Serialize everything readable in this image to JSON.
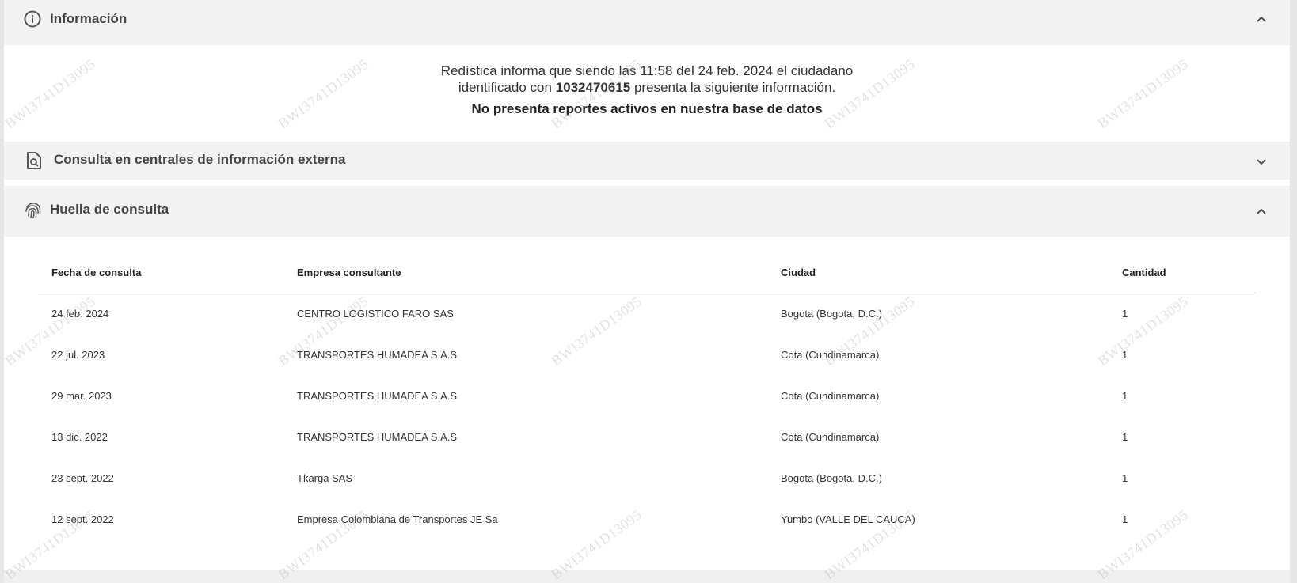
{
  "sections": {
    "informacion": {
      "title": "Información",
      "icon": "info-circle-icon",
      "expanded": true
    },
    "consulta_externa": {
      "title": "Consulta en centrales de información externa",
      "icon": "document-search-icon",
      "expanded": false
    },
    "huella": {
      "title": "Huella de consulta",
      "icon": "fingerprint-icon",
      "expanded": true
    }
  },
  "info": {
    "line1": "Redística informa que siendo las 11:58 del 24 feb. 2024 el ciudadano",
    "line2_prefix": "identificado con ",
    "id_number": "1032470615",
    "line2_suffix": " presenta la siguiente información.",
    "status": "No presenta reportes activos en nuestra base de datos"
  },
  "table": {
    "headers": [
      "Fecha de consulta",
      "Empresa consultante",
      "Ciudad",
      "Cantidad"
    ],
    "rows": [
      [
        "24 feb. 2024",
        "CENTRO LOGISTICO FARO SAS",
        "Bogota (Bogota, D.C.)",
        "1"
      ],
      [
        "22 jul. 2023",
        "TRANSPORTES HUMADEA S.A.S",
        "Cota (Cundinamarca)",
        "1"
      ],
      [
        "29 mar. 2023",
        "TRANSPORTES HUMADEA S.A.S",
        "Cota (Cundinamarca)",
        "1"
      ],
      [
        "13 dic. 2022",
        "TRANSPORTES HUMADEA S.A.S",
        "Cota (Cundinamarca)",
        "1"
      ],
      [
        "23 sept. 2022",
        "Tkarga SAS",
        "Bogota (Bogota, D.C.)",
        "1"
      ],
      [
        "12 sept. 2022",
        "Empresa Colombiana de Transportes JE Sa",
        "Yumbo (VALLE DEL CAUCA)",
        "1"
      ]
    ]
  },
  "watermark_text": "BWI3741D13095",
  "colors": {
    "header_bg": "#f2f2f2",
    "page_bg": "#ffffff",
    "icon": "#555555"
  }
}
